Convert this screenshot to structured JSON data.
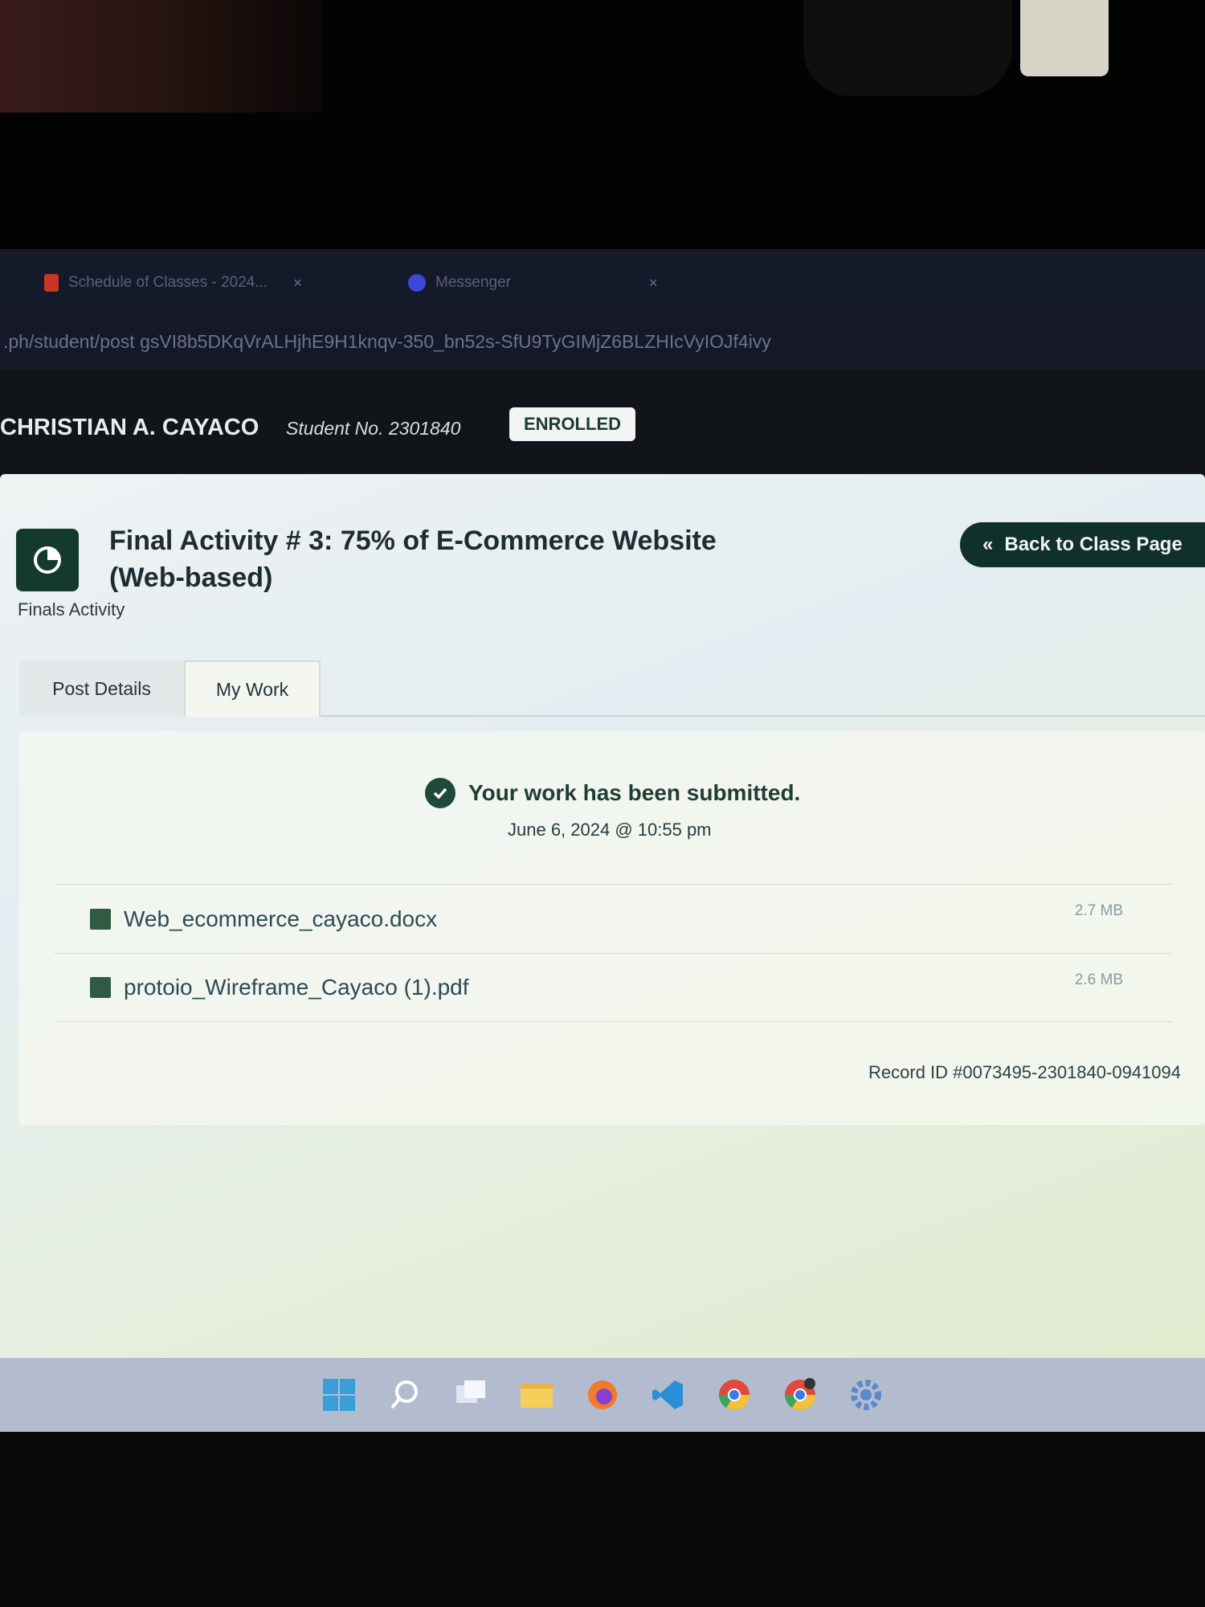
{
  "browser": {
    "tabs": [
      {
        "label": "Schedule of Classes - 2024...",
        "icon": "acrobat-icon"
      },
      {
        "label": "Messenger",
        "icon": "messenger-icon"
      }
    ],
    "url": ".ph/student/post gsVI8b5DKqVrALHjhE9H1knqv-350_bn52s-SfU9TyGIMjZ6BLZHIcVyIOJf4ivy"
  },
  "header": {
    "student_name": "CHRISTIAN A. CAYACO",
    "student_no": "Student No. 2301840",
    "status_badge": "ENROLLED"
  },
  "activity": {
    "title": "Final Activity # 3: 75% of E-Commerce Website (Web-based)",
    "subtitle": "Finals Activity",
    "back_button": "Back to Class Page"
  },
  "tabs": [
    {
      "label": "Post Details"
    },
    {
      "label": "My Work"
    }
  ],
  "submission": {
    "message": "Your work has been submitted.",
    "date": "June 6, 2024 @ 10:55 pm",
    "files": [
      {
        "name": "Web_ecommerce_cayaco.docx",
        "size": "2.7 MB"
      },
      {
        "name": "protoio_Wireframe_Cayaco (1).pdf",
        "size": "2.6 MB"
      }
    ],
    "record_id": "Record ID #0073495-2301840-0941094"
  },
  "taskbar": {
    "icons": [
      "windows-start-icon",
      "search-icon",
      "task-view-icon",
      "file-explorer-icon",
      "firefox-icon",
      "vscode-icon",
      "chrome-icon",
      "chrome-profile-icon",
      "settings-icon"
    ]
  },
  "colors": {
    "accent_dark_green": "#143a2e",
    "badge_bg": "#f2f5f4",
    "tabbar_bg": "#151a2a"
  }
}
